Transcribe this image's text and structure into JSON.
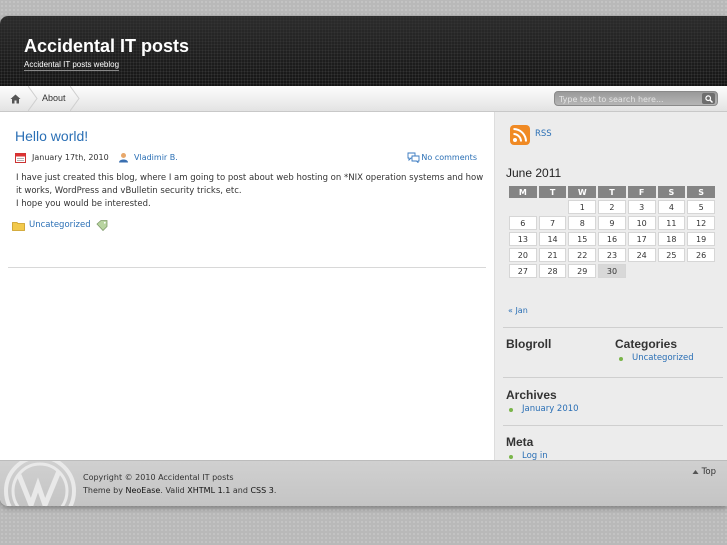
{
  "site": {
    "title": "Accidental IT posts",
    "description": "Accidental IT posts weblog"
  },
  "nav": {
    "home_icon": "home-icon",
    "items": [
      {
        "label": "About"
      }
    ],
    "search_placeholder": "Type text to search here..."
  },
  "post": {
    "title": "Hello world!",
    "date": "January 17th, 2010",
    "author": "Vladimir B.",
    "comments": "No comments",
    "body_line1": "I have just created this blog, where I am going to post about web hosting on *NIX operation systems and how it works, WordPress and vBulletin security tricks, etc.",
    "body_line2": "I hope you would be interested.",
    "category": "Uncategorized"
  },
  "sidebar": {
    "rss_label": "RSS",
    "calendar": {
      "title": "June 2011",
      "days": [
        "M",
        "T",
        "W",
        "T",
        "F",
        "S",
        "S"
      ],
      "weeks": [
        [
          "",
          "",
          "1",
          "2",
          "3",
          "4",
          "5"
        ],
        [
          "6",
          "7",
          "8",
          "9",
          "10",
          "11",
          "12"
        ],
        [
          "13",
          "14",
          "15",
          "16",
          "17",
          "18",
          "19"
        ],
        [
          "20",
          "21",
          "22",
          "23",
          "24",
          "25",
          "26"
        ],
        [
          "27",
          "28",
          "29",
          "30",
          "",
          "",
          ""
        ]
      ],
      "prev_link": "« Jan"
    },
    "blogroll_title": "Blogroll",
    "categories_title": "Categories",
    "categories": [
      "Uncategorized"
    ],
    "archives_title": "Archives",
    "archives": [
      "January 2010"
    ],
    "meta_title": "Meta",
    "meta_links": [
      "Log in"
    ]
  },
  "footer": {
    "copyright": "Copyright © 2010 Accidental IT posts",
    "theme_by": "Theme by",
    "theme_name": "NeoEase",
    "valid": ". Valid",
    "xhtml": "XHTML 1.1",
    "and": "and",
    "css": "CSS 3",
    "end": ".",
    "top_link": "Top"
  },
  "colors": {
    "link": "#2a6fb5",
    "header_bg": "#1e1e1e",
    "rss_orange": "#f08a24",
    "bullet_green": "#7ab54a"
  }
}
